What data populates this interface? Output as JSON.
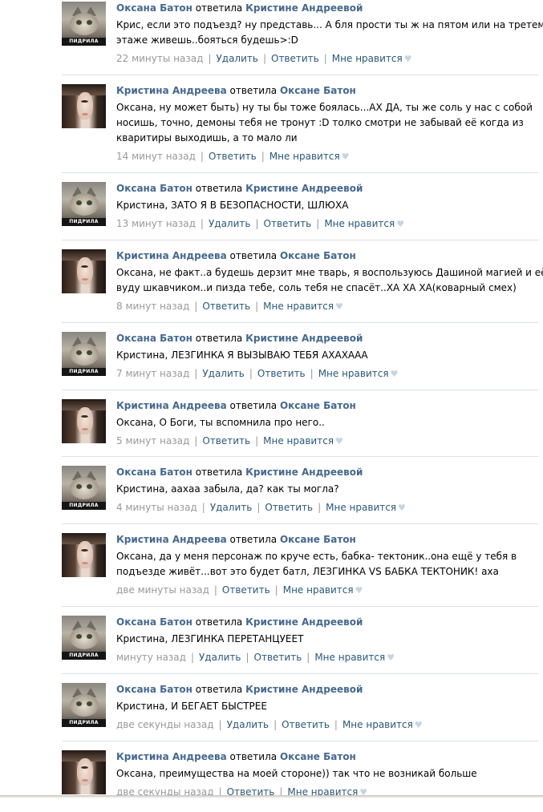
{
  "labels": {
    "replied": "ответила",
    "delete": "Удалить",
    "reply": "Ответить",
    "like": "Мне нравится",
    "separator": "|",
    "heart_icon": "heart-icon"
  },
  "avatar_caption": "ПИДРИЛА ЕБАНАЯ",
  "colors": {
    "link": "#2b587a",
    "name": "#45688e",
    "time": "#999999",
    "divider": "#dae1e8"
  },
  "comments": [
    {
      "avatar": "cat",
      "author": "Оксана Батон",
      "target": "Кристине Андреевой",
      "lines": [
        "Крис, если это подъезд? ну представь... А бля прости ты ж на пятом или на третем",
        "этаже живешь..бояться будешь>:D"
      ],
      "time": "22 минуты назад",
      "can_delete": true
    },
    {
      "avatar": "girl",
      "author": "Кристина Андреева",
      "target": "Оксане Батон",
      "lines": [
        "Оксана, ну может быть) ну ты бы тоже боялась...АХ ДА, ты же соль у нас с собой",
        "носишь, точно, демоны тебя не тронут :D толко смотри не забывай её когда из",
        "кваритиры выходишь, а то мало ли"
      ],
      "time": "14 минут назад",
      "can_delete": false
    },
    {
      "avatar": "cat",
      "author": "Оксана Батон",
      "target": "Кристине Андреевой",
      "lines": [
        "Кристина, ЗАТО Я В БЕЗОПАСНОСТИ, ШЛЮХА"
      ],
      "time": "13 минут назад",
      "can_delete": true
    },
    {
      "avatar": "girl",
      "author": "Кристина Андреева",
      "target": "Оксане Батон",
      "lines": [
        "Оксана, не факт..а будешь дерзит мне тварь, я воспользуюсь Дашиной магией и её",
        "вуду шкавчиком..и пизда тебе, соль тебя не спасёт..ХА ХА ХА(коварный смех)"
      ],
      "time": "8 минут назад",
      "can_delete": false
    },
    {
      "avatar": "cat",
      "author": "Оксана Батон",
      "target": "Кристине Андреевой",
      "lines": [
        "Кристина, ЛЕЗГИНКА Я ВЫЗЫВАЮ ТЕБЯ АХАХААА"
      ],
      "time": "7 минут назад",
      "can_delete": true
    },
    {
      "avatar": "girl",
      "author": "Кристина Андреева",
      "target": "Оксане Батон",
      "lines": [
        "Оксана, О Боги, ты вспомнила про него.."
      ],
      "time": "5 минут назад",
      "can_delete": false
    },
    {
      "avatar": "cat",
      "author": "Оксана Батон",
      "target": "Кристине Андреевой",
      "lines": [
        "Кристина, аахаа забыла, да? как ты могла?"
      ],
      "time": "4 минуты назад",
      "can_delete": true
    },
    {
      "avatar": "girl",
      "author": "Кристина Андреева",
      "target": "Оксане Батон",
      "lines": [
        "Оксана, да у меня персонаж по круче есть, бабка- тектоник..она ещё у тебя в",
        "подъезде живёт...вот это будет батл, ЛЕЗГИНКА VS БАБКА ТЕКТОНИК! аха"
      ],
      "time": "две минуты назад",
      "can_delete": false
    },
    {
      "avatar": "cat",
      "author": "Оксана Батон",
      "target": "Кристине Андреевой",
      "lines": [
        "Кристина, ЛЕЗГИНКА ПЕРЕТАНЦУЕЕТ"
      ],
      "time": "минуту назад",
      "can_delete": true
    },
    {
      "avatar": "cat",
      "author": "Оксана Батон",
      "target": "Кристине Андреевой",
      "lines": [
        "Кристина, И БЕГАЕТ БЫСТРЕЕ"
      ],
      "time": "две секунды назад",
      "can_delete": true
    },
    {
      "avatar": "girl",
      "author": "Кристина Андреева",
      "target": "Оксане Батон",
      "lines": [
        "Оксана, преимущества на моей стороне)) так что не возникай больше"
      ],
      "time": "две секунды назад",
      "can_delete": false
    }
  ]
}
